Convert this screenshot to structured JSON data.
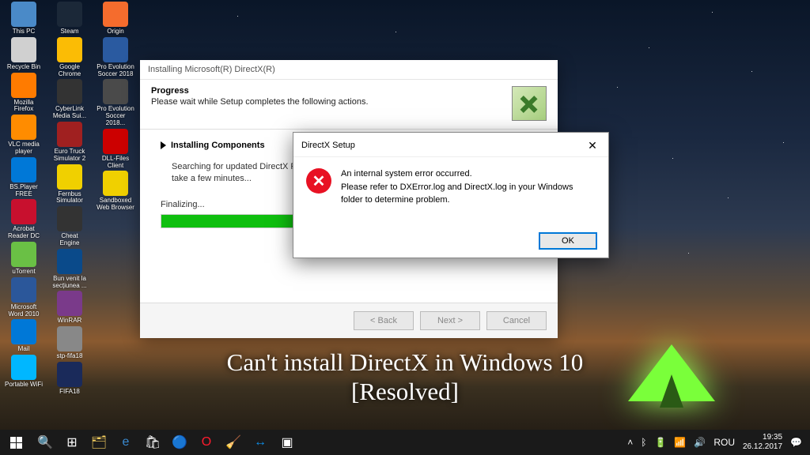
{
  "desktop_icons": [
    {
      "label": "This PC",
      "color": "#4a8ac8"
    },
    {
      "label": "Recycle Bin",
      "color": "#d0d0d0"
    },
    {
      "label": "Mozilla Firefox",
      "color": "#ff7b00"
    },
    {
      "label": "VLC media player",
      "color": "#ff8c00"
    },
    {
      "label": "BS.Player FREE",
      "color": "#0078d7"
    },
    {
      "label": "Acrobat Reader DC",
      "color": "#c8102e"
    },
    {
      "label": "uTorrent",
      "color": "#6ac045"
    },
    {
      "label": "Microsoft Word 2010",
      "color": "#2b579a"
    },
    {
      "label": "Mail",
      "color": "#0078d7"
    },
    {
      "label": "Portable WiFi",
      "color": "#00b7ff"
    },
    {
      "label": "Steam",
      "color": "#1b2838"
    },
    {
      "label": "Google Chrome",
      "color": "#fbbc05"
    },
    {
      "label": "CyberLink Media Sui...",
      "color": "#333"
    },
    {
      "label": "Euro Truck Simulator 2",
      "color": "#a02020"
    },
    {
      "label": "Fernbus Simulator",
      "color": "#f0d000"
    },
    {
      "label": "Cheat Engine",
      "color": "#333"
    },
    {
      "label": "Bun venit la secțiunea ...",
      "color": "#0a4a8a"
    },
    {
      "label": "WinRAR",
      "color": "#7a3a8a"
    },
    {
      "label": "stp-fifa18",
      "color": "#888"
    },
    {
      "label": "FIFA18",
      "color": "#1a2a5a"
    },
    {
      "label": "Origin",
      "color": "#f56c2d"
    },
    {
      "label": "Pro Evolution Soccer 2018",
      "color": "#2a5aa0"
    },
    {
      "label": "Pro Evolution Soccer 2018...",
      "color": "#4a4a4a"
    },
    {
      "label": "DLL-Files Client",
      "color": "#c00"
    },
    {
      "label": "Sandboxed Web Browser",
      "color": "#f0d000"
    }
  ],
  "installer": {
    "title": "Installing Microsoft(R) DirectX(R)",
    "progress_heading": "Progress",
    "progress_sub": "Please wait while Setup completes the following actions.",
    "step": "Installing Components",
    "desc": "Searching for updated DirectX Runtime Components and updating as necessary. This may take a few minutes...",
    "finalizing": "Finalizing...",
    "back": "< Back",
    "next": "Next >",
    "cancel": "Cancel"
  },
  "error": {
    "title": "DirectX Setup",
    "line1": "An internal system error occurred.",
    "line2": "Please refer to DXError.log and DirectX.log in your Windows folder to determine problem.",
    "ok": "OK"
  },
  "caption": {
    "line1": "Can't install DirectX in Windows 10",
    "line2": "[Resolved]"
  },
  "taskbar": {
    "time": "19:35",
    "date": "26.12.2017",
    "lang": "ROU"
  }
}
